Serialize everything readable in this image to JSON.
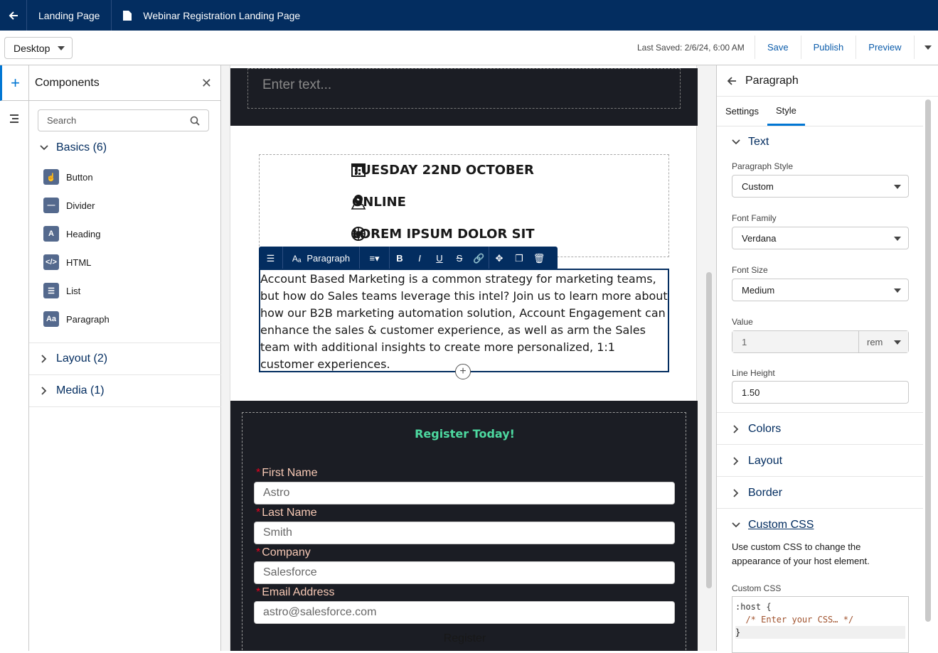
{
  "header": {
    "tab1": "Landing Page",
    "tab2": "Webinar Registration Landing Page"
  },
  "toolbar": {
    "device": "Desktop",
    "last_saved": "Last Saved: 2/6/24, 6:00 AM",
    "save": "Save",
    "publish": "Publish",
    "preview": "Preview"
  },
  "components": {
    "title": "Components",
    "search_placeholder": "Search",
    "basics": "Basics (6)",
    "items": [
      "Button",
      "Divider",
      "Heading",
      "HTML",
      "List",
      "Paragraph"
    ],
    "layout": "Layout (2)",
    "media": "Media (1)"
  },
  "canvas": {
    "enter_text": "Enter text...",
    "event_lines": [
      "TUESDAY 22ND OCTOBER",
      "ONLINE",
      "LOREM IPSUM DOLOR SIT"
    ],
    "rte_label": "Paragraph",
    "paragraph": "Account Based Marketing is a common strategy for marketing teams, but how do Sales teams leverage this intel? Join us to learn more about how our B2B marketing automation solution, Account Engagement can enhance the sales & customer experience, as well as arm the Sales team with additional insights to create more personalized, 1:1 customer experiences.",
    "register_heading": "Register Today!",
    "fields": [
      {
        "label": "First Name",
        "value": "Astro"
      },
      {
        "label": "Last Name",
        "value": "Smith"
      },
      {
        "label": "Company",
        "value": "Salesforce"
      },
      {
        "label": "Email Address",
        "value": "astro@salesforce.com"
      }
    ],
    "register_button": "Register"
  },
  "properties": {
    "title": "Paragraph",
    "tabs": [
      "Settings",
      "Style"
    ],
    "text_section": "Text",
    "paragraph_style_label": "Paragraph Style",
    "paragraph_style": "Custom",
    "font_family_label": "Font Family",
    "font_family": "Verdana",
    "font_size_label": "Font Size",
    "font_size": "Medium",
    "value_label": "Value",
    "value": "1",
    "unit": "rem",
    "line_height_label": "Line Height",
    "line_height": "1.50",
    "colors": "Colors",
    "layout": "Layout",
    "border": "Border",
    "custom_css": "Custom CSS",
    "css_desc": "Use custom CSS to change the appearance of your host element.",
    "css_label": "Custom CSS",
    "code": [
      ":host {",
      "  /* Enter your CSS… */",
      "}"
    ]
  },
  "colors": {
    "navy": "#032d60",
    "accent": "#0176d3",
    "register": "#4dd9a0"
  }
}
